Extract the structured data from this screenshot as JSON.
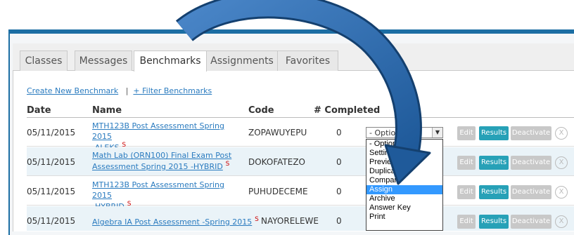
{
  "tabs": [
    "Classes",
    "Messages",
    "Benchmarks",
    "Assignments",
    "Favorites"
  ],
  "active_tab": "Benchmarks",
  "links": {
    "create": "Create New Benchmark",
    "separator": "|",
    "filter": "+ Filter Benchmarks"
  },
  "columns": {
    "date": "Date",
    "name": "Name",
    "code": "Code",
    "completed": "# Completed"
  },
  "rows": [
    {
      "date": "05/11/2015",
      "name_l1": "MTH123B Post Assessment Spring 2015",
      "name_l2": "-ALEKS",
      "flag": "S",
      "code": "ZOPAWUYEPU",
      "completed": "0"
    },
    {
      "date": "05/11/2015",
      "name_l1": "Math Lab (ORN100) Final Exam Post",
      "name_l2": "Assessment Spring 2015 -HYBRID",
      "flag": "S",
      "code": "DOKOFATEZO",
      "completed": "0"
    },
    {
      "date": "05/11/2015",
      "name_l1": "MTH123B Post Assessment Spring 2015",
      "name_l2": "-HYBRID",
      "flag": "S",
      "code": "PUHUDECEME",
      "completed": "0"
    },
    {
      "date": "05/11/2015",
      "name_l1": "Algebra IA Post Assessment -Spring 2015",
      "name_l2": "",
      "flag": "S",
      "code": "NAYORELEWE",
      "completed": "0"
    }
  ],
  "row_buttons": {
    "edit": "Edit",
    "results": "Results",
    "deactivate": "Deactivate",
    "remove": "X"
  },
  "select_value": "- Options -",
  "dropdown_options": [
    "- Options -",
    "Settings",
    "Preview",
    "Duplicate",
    "Compare",
    "Assign",
    "Archive",
    "Answer Key",
    "Print"
  ],
  "selected_option": "Assign",
  "colors": {
    "accent": "#1c6ea4",
    "teal": "#27a1b7",
    "link": "#2a7bbf",
    "arrow": "#2f6fb3"
  }
}
